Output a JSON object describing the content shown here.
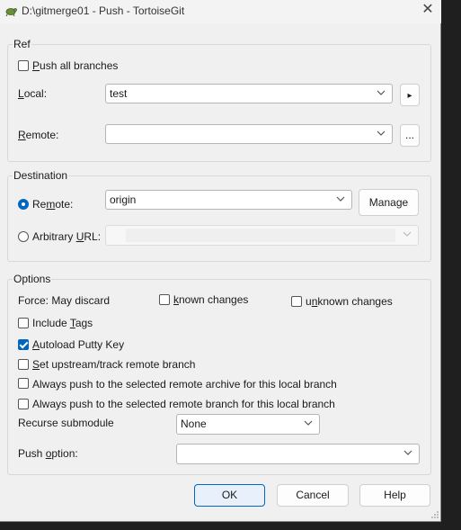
{
  "window": {
    "title": "D:\\gitmerge01 - Push - TortoiseGit",
    "icon": "tortoise-icon",
    "close_icon": "close-icon"
  },
  "ref": {
    "legend": "Ref",
    "push_all_branches": {
      "label": "Push all branches",
      "checked": false
    },
    "local_label": "Local:",
    "local_value": "test",
    "local_arrow_button": "▸",
    "remote_label": "Remote:",
    "remote_value": "",
    "remote_browse_button": "..."
  },
  "destination": {
    "legend": "Destination",
    "remote_radio": {
      "label": "Remote:",
      "selected": true
    },
    "remote_value": "origin",
    "manage_button": "Manage",
    "arbitrary_url_radio": {
      "label": "Arbitrary URL:",
      "selected": false
    },
    "url_value": ""
  },
  "options": {
    "legend": "Options",
    "force_label": "Force: May discard",
    "known_changes": {
      "label": "known changes",
      "checked": false
    },
    "unknown_changes": {
      "label": "unknown changes",
      "checked": false
    },
    "include_tags": {
      "label": "Include Tags",
      "checked": false
    },
    "autoload_putty_key": {
      "label": "Autoload Putty Key",
      "checked": true
    },
    "set_upstream": {
      "label": "Set upstream/track remote branch",
      "checked": false
    },
    "push_to_archive": {
      "label": "Always push to the selected remote archive for this local branch",
      "checked": false
    },
    "push_to_branch": {
      "label": "Always push to the selected remote branch for this local branch",
      "checked": false
    },
    "recurse_label": "Recurse submodule",
    "recurse_value": "None",
    "push_option_label": "Push option:",
    "push_option_value": ""
  },
  "buttons": {
    "ok": "OK",
    "cancel": "Cancel",
    "help": "Help"
  },
  "colors": {
    "accent": "#0067c0",
    "dialog_bg": "#f0f0f0",
    "backdrop": "#1f1f1f"
  }
}
